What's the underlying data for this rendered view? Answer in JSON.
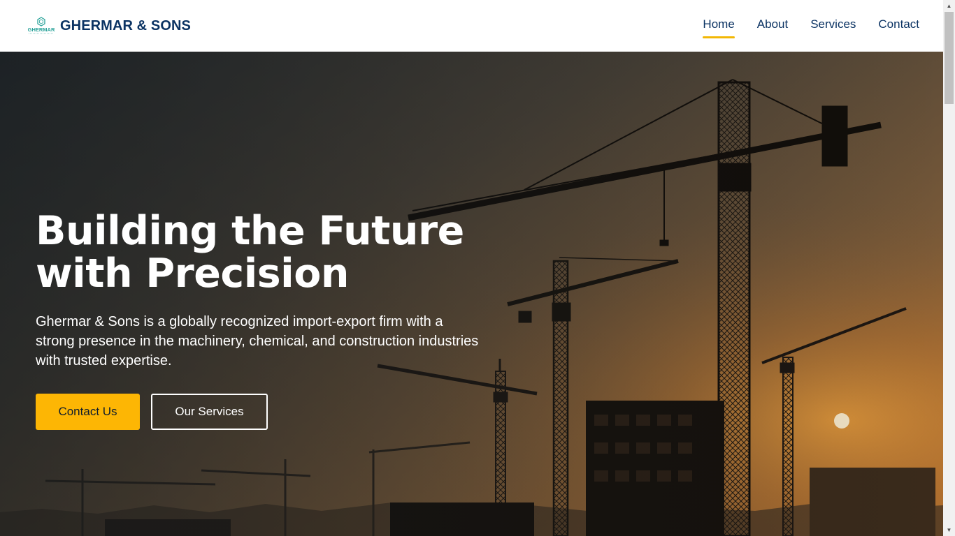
{
  "header": {
    "logo_text": "GHERMAR",
    "brand_name": "GHERMAR & SONS",
    "nav": [
      {
        "label": "Home",
        "active": true
      },
      {
        "label": "About",
        "active": false
      },
      {
        "label": "Services",
        "active": false
      },
      {
        "label": "Contact",
        "active": false
      }
    ]
  },
  "hero": {
    "title_line1": "Building the Future",
    "title_line2": "with Precision",
    "description": "Ghermar & Sons is a globally recognized import-export firm with a strong presence in the machinery, chemical, and construction industries with trusted expertise.",
    "primary_button": "Contact Us",
    "secondary_button": "Our Services",
    "background_icon": "construction-cranes-sunset-image"
  },
  "colors": {
    "brand_navy": "#0b3363",
    "accent_yellow": "#fdb604",
    "nav_underline": "#f2b705",
    "logo_teal": "#2aa39a"
  }
}
